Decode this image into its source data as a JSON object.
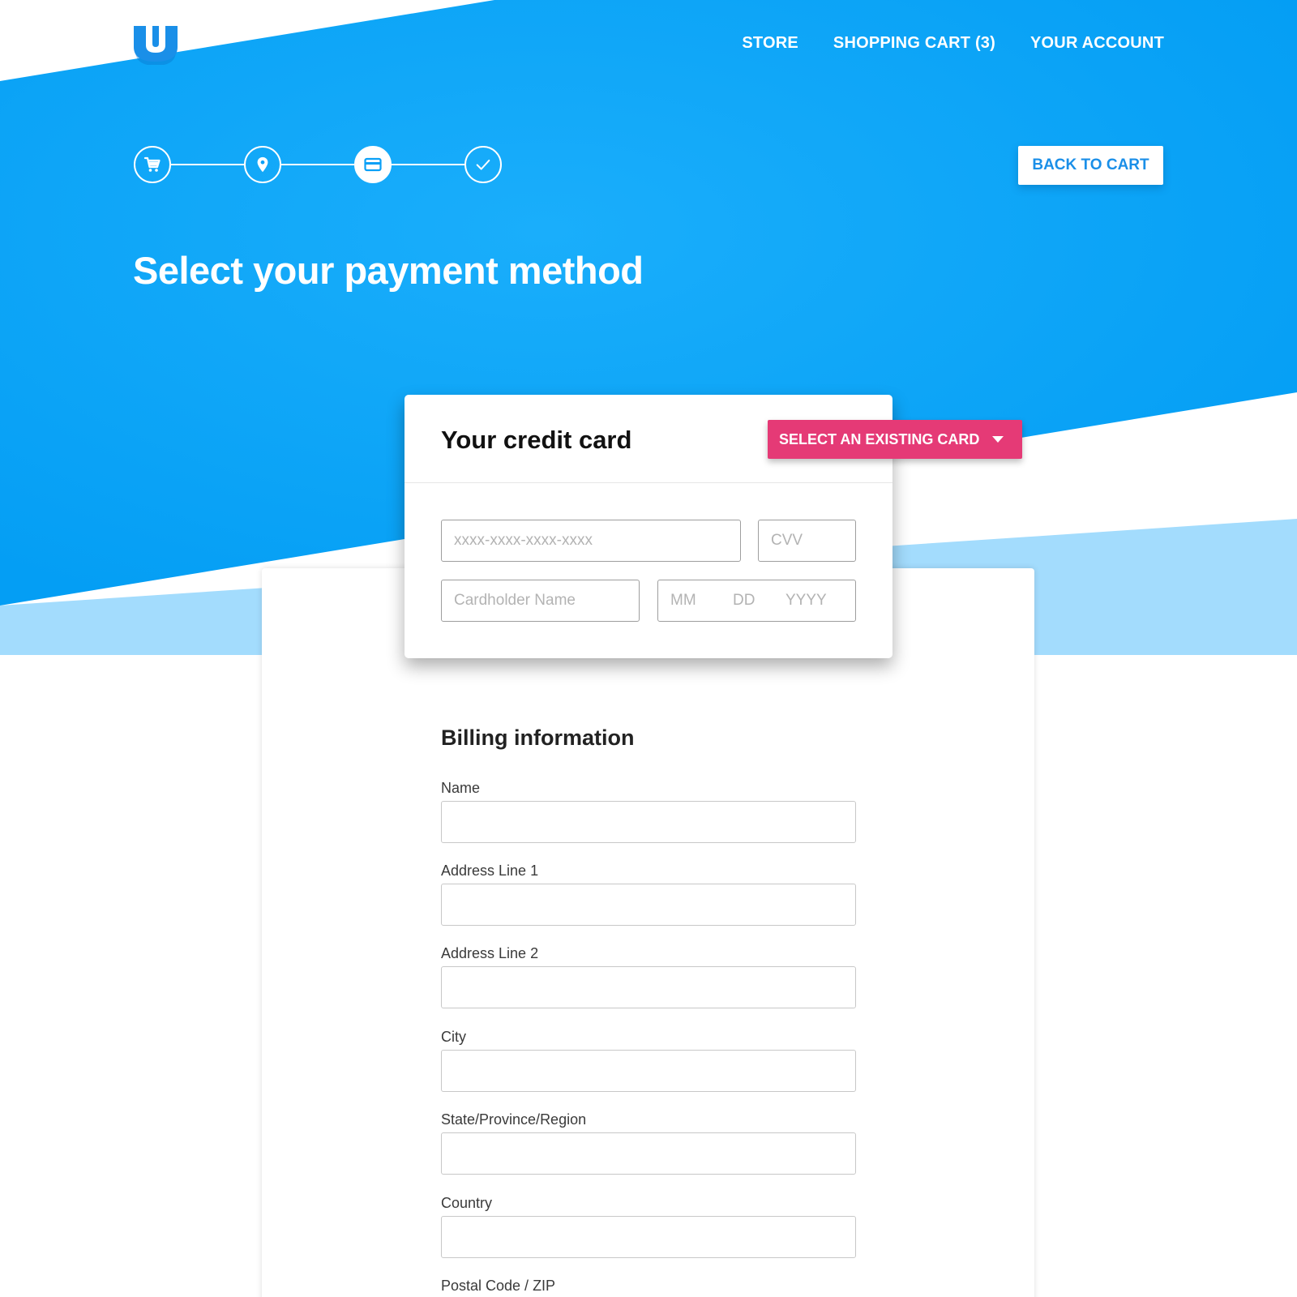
{
  "header": {
    "logo_icon": "u-shield-logo-icon",
    "nav": [
      {
        "label": "STORE"
      },
      {
        "label": "SHOPPING CART (3)"
      },
      {
        "label": "YOUR ACCOUNT"
      }
    ]
  },
  "stepper": {
    "steps": [
      {
        "icon": "cart-icon",
        "state": "done"
      },
      {
        "icon": "location-pin-icon",
        "state": "done"
      },
      {
        "icon": "credit-card-icon",
        "state": "active"
      },
      {
        "icon": "checkmark-icon",
        "state": "pending"
      }
    ]
  },
  "back_button": {
    "label": "BACK TO CART"
  },
  "page_title": "Select your payment method",
  "credit_card": {
    "title": "Your credit card",
    "select_existing_label": "SELECT AN EXISTING CARD",
    "number_placeholder": "xxxx-xxxx-xxxx-xxxx",
    "cvv_placeholder": "CVV",
    "holder_placeholder": "Cardholder Name",
    "date_month": "MM",
    "date_day": "DD",
    "date_year": "YYYY"
  },
  "billing": {
    "title": "Billing information",
    "fields": [
      {
        "label": "Name",
        "value": ""
      },
      {
        "label": "Address Line 1",
        "value": ""
      },
      {
        "label": "Address Line 2",
        "value": ""
      },
      {
        "label": "City",
        "value": ""
      },
      {
        "label": "State/Province/Region",
        "value": ""
      },
      {
        "label": "Country",
        "value": ""
      },
      {
        "label": "Postal Code / ZIP",
        "value": ""
      }
    ]
  },
  "colors": {
    "primary_blue": "#0aa0f7",
    "light_blue": "#a3dcfd",
    "accent_pink": "#e53a76",
    "button_text_blue": "#1a8fe8"
  }
}
